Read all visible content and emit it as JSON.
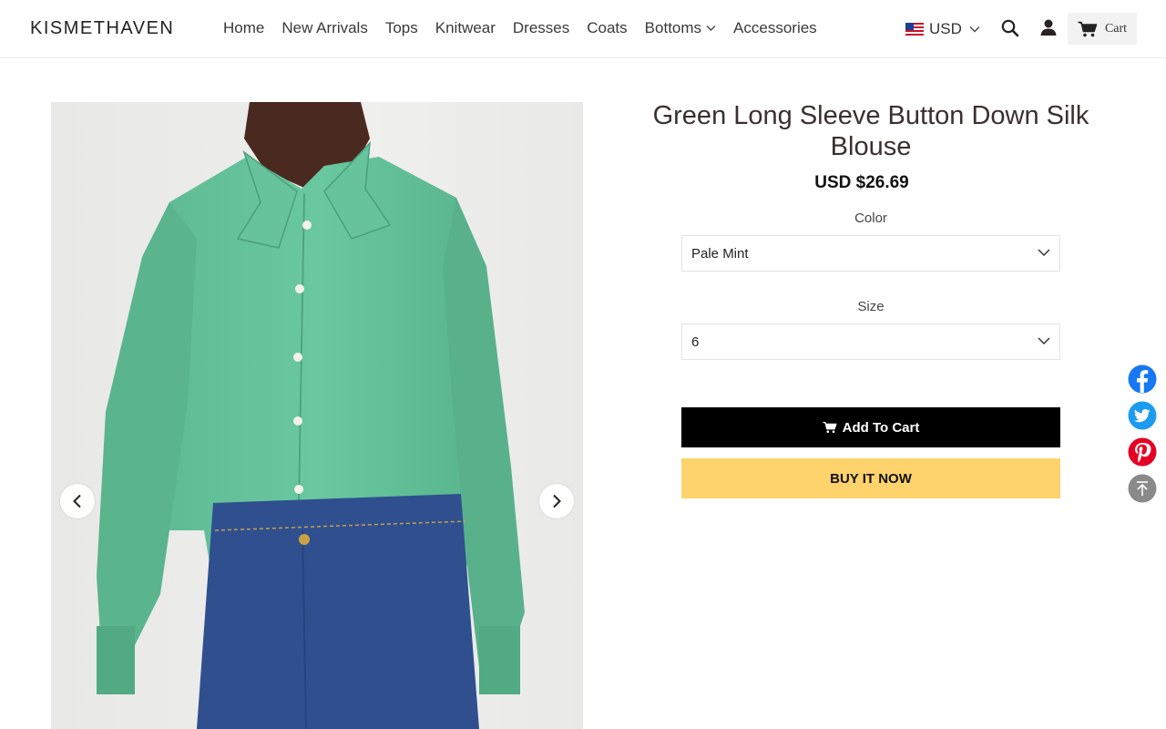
{
  "header": {
    "logo": "KISMETHAVEN",
    "nav": [
      {
        "label": "Home"
      },
      {
        "label": "New Arrivals"
      },
      {
        "label": "Tops"
      },
      {
        "label": "Knitwear"
      },
      {
        "label": "Dresses"
      },
      {
        "label": "Coats"
      },
      {
        "label": "Bottoms",
        "has_dropdown": true
      },
      {
        "label": "Accessories"
      }
    ],
    "currency": "USD",
    "cart_label": "Cart"
  },
  "product": {
    "title": "Green Long Sleeve Button Down Silk Blouse",
    "price": "USD $26.69",
    "color_label": "Color",
    "color_value": "Pale Mint",
    "size_label": "Size",
    "size_value": "6",
    "add_to_cart": "Add To Cart",
    "buy_now": "BUY IT NOW"
  },
  "colors": {
    "accent_buy": "#ffd36b",
    "blouse": "#5fbe95",
    "denim": "#2f4f8f"
  }
}
